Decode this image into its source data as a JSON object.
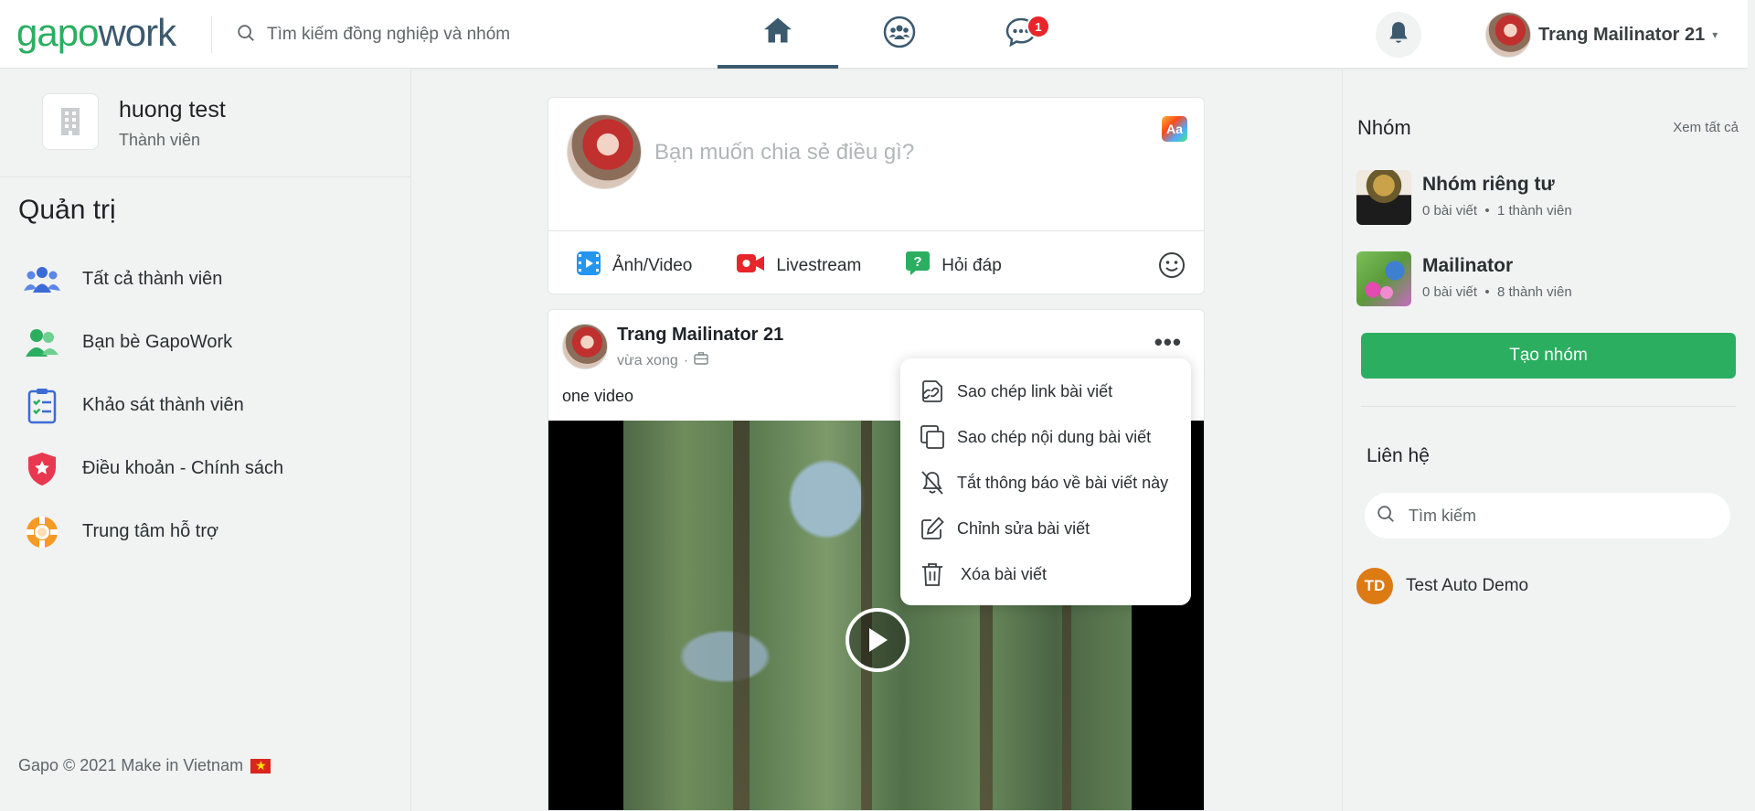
{
  "header": {
    "logo_part1": "gapo",
    "logo_part2": "work",
    "search_placeholder": "Tìm kiếm đồng nghiệp và nhóm",
    "chat_badge": "1",
    "user_name": "Trang Mailinator 21",
    "caret": "▾"
  },
  "workspace": {
    "name": "huong test",
    "role": "Thành viên"
  },
  "admin": {
    "title": "Quản trị",
    "items": [
      {
        "label": "Tất cả thành viên",
        "icon": "people-icon"
      },
      {
        "label": "Bạn bè GapoWork",
        "icon": "friends-icon"
      },
      {
        "label": "Khảo sát thành viên",
        "icon": "survey-icon"
      },
      {
        "label": "Điều khoản - Chính sách",
        "icon": "shield-icon"
      },
      {
        "label": "Trung tâm hỗ trợ",
        "icon": "lifebuoy-icon"
      }
    ]
  },
  "footer": {
    "text": "Gapo © 2021 Make in Vietnam"
  },
  "composer": {
    "placeholder": "Bạn muốn chia sẻ điều gì?",
    "aa": "Aa",
    "actions": {
      "photo": "Ảnh/Video",
      "live": "Livestream",
      "qa": "Hỏi đáp"
    }
  },
  "post": {
    "author": "Trang Mailinator 21",
    "time": "vừa xong",
    "dot": "·",
    "more": "•••",
    "content": "one video"
  },
  "context_menu": {
    "items": [
      {
        "label": "Sao chép link bài viết",
        "icon": "link-copy-icon"
      },
      {
        "label": "Sao chép nội dung bài viết",
        "icon": "copy-icon"
      },
      {
        "label": "Tắt thông báo về bài viết này",
        "icon": "bell-off-icon"
      },
      {
        "label": "Chỉnh sửa bài viết",
        "icon": "edit-icon"
      },
      {
        "label": "Xóa bài viết",
        "icon": "trash-icon"
      }
    ]
  },
  "groups": {
    "title": "Nhóm",
    "see_all": "Xem tất cả",
    "items": [
      {
        "name": "Nhóm riêng tư",
        "posts": "0 bài viết",
        "members": "1 thành viên"
      },
      {
        "name": "Mailinator",
        "posts": "0 bài viết",
        "members": "8 thành viên"
      }
    ],
    "create_label": "Tạo nhóm"
  },
  "contacts": {
    "title": "Liên hệ",
    "search_placeholder": "Tìm kiếm",
    "items": [
      {
        "initials": "TD",
        "name": "Test Auto Demo"
      }
    ]
  },
  "colors": {
    "brand_green": "#2bae60",
    "brand_navy": "#3c5a6e",
    "badge_red": "#e8252b"
  }
}
